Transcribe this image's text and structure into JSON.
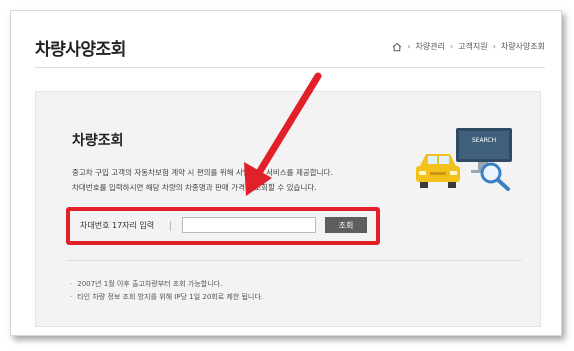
{
  "header": {
    "title": "차량사양조회",
    "breadcrumb": [
      "차량관리",
      "고객지원",
      "차량사양조회"
    ],
    "breadcrumb_separator": "›"
  },
  "section": {
    "title": "차량조회",
    "description": [
      "중고차 구입 고객의 자동차보험 계약 시 편의를 위해 사양조회 서비스를 제공합니다.",
      "차대번호를 입력하시면 해당 차량의 차종명과 판매 가격을 조회할 수 있습니다."
    ]
  },
  "search": {
    "label": "차대번호 17자리 입력",
    "input_value": "",
    "button_label": "조회"
  },
  "notes": [
    "2007년 1월 이후 출고차량부터 조회 가능합니다.",
    "타인 차량 정보 조회 방지를 위해 IP당 1일 20회로 제한 됩니다."
  ],
  "illustration": {
    "screen_text": "SEARCH",
    "icons": [
      "car-icon",
      "monitor-icon",
      "magnifier-icon"
    ]
  },
  "colors": {
    "highlight_red": "#e2202a",
    "panel_gray": "#f3f3f3",
    "button_gray": "#5e5e5e",
    "car_yellow": "#f2c21b",
    "monitor_navy": "#2f4a63",
    "magnifier_blue": "#3a7fc4"
  }
}
